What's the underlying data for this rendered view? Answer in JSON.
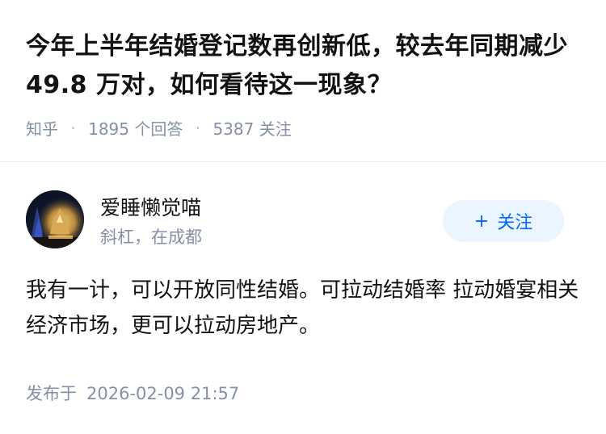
{
  "question": {
    "title": "今年上半年结婚登记数再创新低，较去年同期减少 49.8 万对，如何看待这一现象？",
    "source": "知乎",
    "answers_count": "1895 个回答",
    "followers_count": "5387 关注"
  },
  "author": {
    "name": "爱睡懒觉喵",
    "bio": "斜杠，在成都",
    "follow_label": "关注",
    "follow_icon": "plus-icon",
    "accent_color": "#0066ff"
  },
  "answer": {
    "text": "我有一计，可以开放同性结婚。可拉动结婚率 拉动婚宴相关经济市场，更可以拉动房地产。",
    "published_label": "发布于",
    "published_time": "2026-02-09 21:57"
  }
}
